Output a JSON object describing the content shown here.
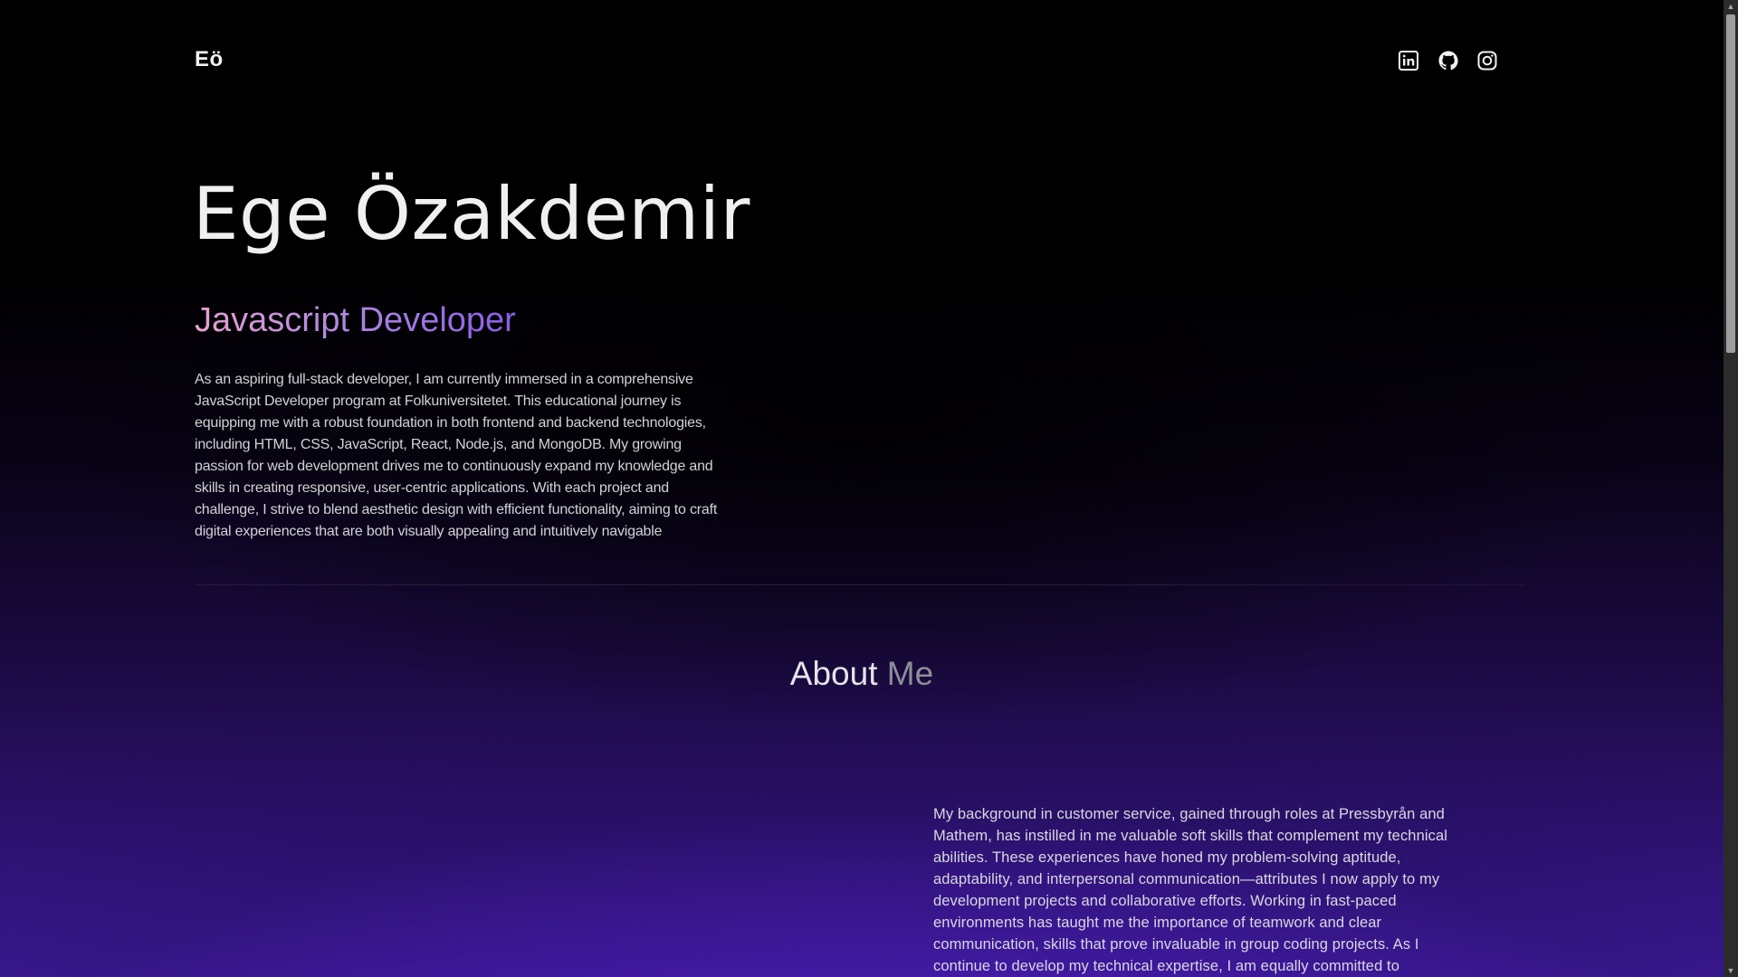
{
  "header": {
    "logo": "Eö",
    "socials": [
      {
        "name": "linkedin-icon"
      },
      {
        "name": "github-icon"
      },
      {
        "name": "instagram-icon"
      }
    ]
  },
  "hero": {
    "name": "Ege Özakdemir",
    "role": "Javascript Developer",
    "intro": "As an aspiring full-stack developer, I am currently immersed in a comprehensive JavaScript Developer program at Folkuniversitetet. This educational journey is equipping me with a robust foundation in both frontend and backend technologies, including HTML, CSS, JavaScript, React, Node.js, and MongoDB. My growing passion for web development drives me to continuously expand my knowledge and skills in creating responsive, user-centric applications. With each project and challenge, I strive to blend aesthetic design with efficient functionality, aiming to craft digital experiences that are both visually appealing and intuitively navigable"
  },
  "about": {
    "title_main": "About",
    "title_muted": "Me",
    "text": "My background in customer service, gained through roles at Pressbyrån and Mathem, has instilled in me valuable soft skills that complement my technical abilities. These experiences have honed my problem-solving aptitude, adaptability, and interpersonal communication—attributes I now apply to my development projects and collaborative efforts. Working in fast-paced environments has taught me the importance of teamwork and clear communication, skills that prove invaluable in group coding projects. As I continue to develop my technical expertise, I am equally committed to"
  },
  "colors": {
    "background": "#000000",
    "gradient_purple": "#3d1a9a",
    "role_gradient_start": "#e8a0d0",
    "role_gradient_end": "#8a5ce8"
  }
}
